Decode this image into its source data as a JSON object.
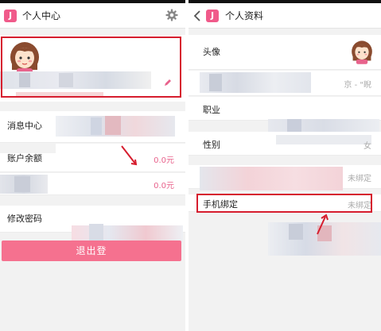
{
  "left_screen": {
    "header": {
      "logo_letter": "J",
      "title": "个人中心"
    },
    "profile": {
      "avatar": "girl-avatar",
      "edit_icon": "pencil-icon"
    },
    "rows": [
      {
        "label": "消息中心",
        "value": ""
      },
      {
        "label": "账户余额",
        "value": "0.0元"
      },
      {
        "label": "",
        "value": "0.0元"
      },
      {
        "label": "修改密码",
        "value": ""
      }
    ],
    "logout_label": "退出登"
  },
  "right_screen": {
    "header": {
      "logo_letter": "J",
      "title": "个人资料"
    },
    "rows": [
      {
        "label": "头像",
        "value": ""
      },
      {
        "label": "",
        "value": "京 - \"睨"
      },
      {
        "label": "职业",
        "value": ""
      },
      {
        "label": "性别",
        "value": "女"
      },
      {
        "label": "",
        "value": "未绑定"
      },
      {
        "label": "手机绑定",
        "value": "未绑定"
      }
    ]
  },
  "colors": {
    "accent_pink": "#f05a8a",
    "highlight_red": "#d61d2e",
    "logout_pink": "#f5718f"
  }
}
